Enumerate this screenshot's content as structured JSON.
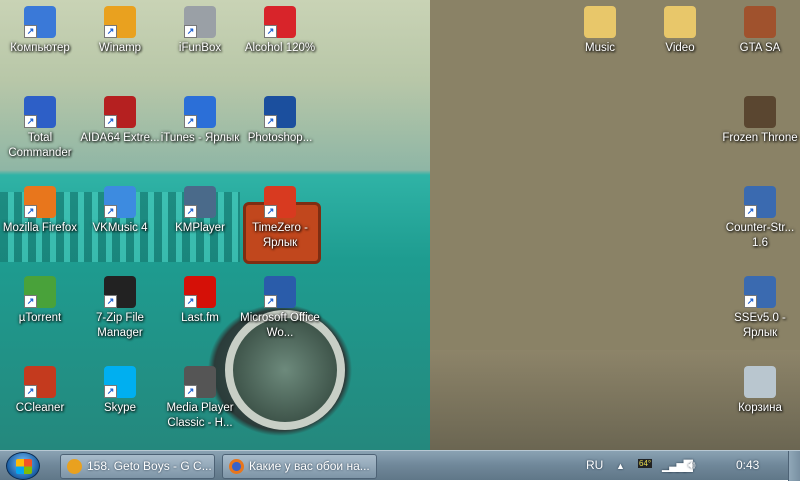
{
  "desktop_icons": [
    {
      "label": "Компьютер",
      "icon": "computer-icon",
      "color": "#3a79d8"
    },
    {
      "label": "Winamp",
      "icon": "winamp-icon",
      "color": "#e9a11f"
    },
    {
      "label": "iFunBox",
      "icon": "ifunbox-icon",
      "color": "#9aa0a6"
    },
    {
      "label": "Alcohol 120%",
      "icon": "alcohol-icon",
      "color": "#d8242a"
    },
    {
      "label": "Total Commander",
      "icon": "total-commander-icon",
      "color": "#2d5fc7"
    },
    {
      "label": "AIDA64 Extre...",
      "icon": "aida64-icon",
      "color": "#b52020"
    },
    {
      "label": "iTunes - Ярлык",
      "icon": "itunes-icon",
      "color": "#2b6fd8"
    },
    {
      "label": "Photoshop...",
      "icon": "photoshop-icon",
      "color": "#1b4f9e"
    },
    {
      "label": "Mozilla Firefox",
      "icon": "firefox-icon",
      "color": "#e8761c"
    },
    {
      "label": "VKMusic 4",
      "icon": "vkmusic-icon",
      "color": "#3d8be0"
    },
    {
      "label": "KMPlayer",
      "icon": "kmplayer-icon",
      "color": "#4a6a8a"
    },
    {
      "label": "TimeZero - Ярлык",
      "icon": "timezero-icon",
      "color": "#d83a20"
    },
    {
      "label": "µTorrent",
      "icon": "utorrent-icon",
      "color": "#49a23a"
    },
    {
      "label": "7-Zip File Manager",
      "icon": "7zip-icon",
      "color": "#222222"
    },
    {
      "label": "Last.fm",
      "icon": "lastfm-icon",
      "color": "#d51007"
    },
    {
      "label": "Microsoft Office Wo...",
      "icon": "word-icon",
      "color": "#2a5caa"
    },
    {
      "label": "CCleaner",
      "icon": "ccleaner-icon",
      "color": "#c43a1e"
    },
    {
      "label": "Skype",
      "icon": "skype-icon",
      "color": "#00aff0"
    },
    {
      "label": "Media Player Classic - H...",
      "icon": "media-player-classic-icon",
      "color": "#555555"
    },
    {
      "label": "Music",
      "icon": "folder-icon",
      "color": "#e8c76a"
    },
    {
      "label": "Video",
      "icon": "folder-icon",
      "color": "#e8c76a"
    },
    {
      "label": "GTA SA",
      "icon": "gta-sa-icon",
      "color": "#a0522d"
    },
    {
      "label": "Frozen Throne",
      "icon": "frozen-throne-icon",
      "color": "#5a4630"
    },
    {
      "label": "Counter-Str... 1.6",
      "icon": "counter-strike-icon",
      "color": "#3a6ab0"
    },
    {
      "label": "SSEv5.0 - Ярлык",
      "icon": "counter-strike-icon",
      "color": "#3a6ab0"
    },
    {
      "label": "Корзина",
      "icon": "recycle-bin-icon",
      "color": "#b9c6cf"
    }
  ],
  "taskbar": {
    "tasks": [
      {
        "label": "158. Geto Boys - G C...",
        "icon": "winamp-icon",
        "color": "#e9a11f"
      },
      {
        "label": "Какие у вас обои на...",
        "icon": "firefox-icon",
        "color": "#e8761c"
      }
    ],
    "language": "RU",
    "temperature_badge": "64°",
    "clock": "0:43"
  }
}
